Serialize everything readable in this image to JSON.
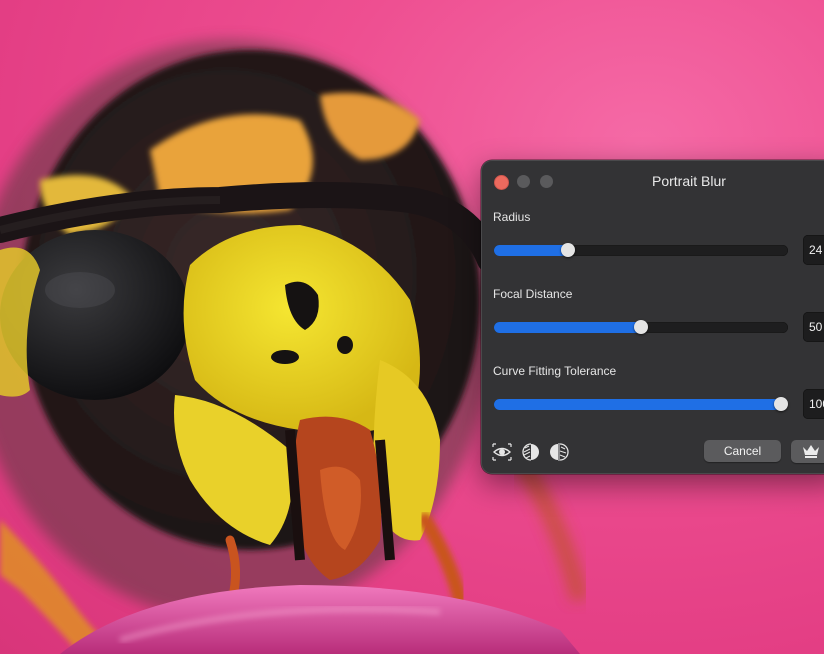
{
  "dialog": {
    "title": "Portrait Blur",
    "sliders": [
      {
        "label": "Radius",
        "value": "24",
        "fraction": 0.24
      },
      {
        "label": "Focal Distance",
        "value": "50",
        "fraction": 0.5
      },
      {
        "label": "Curve Fitting Tolerance",
        "value": "100",
        "fraction": 1.0
      }
    ],
    "buttons": {
      "cancel": "Cancel"
    },
    "icons": [
      "eye-icon",
      "compare-split-icon",
      "compare-mirror-icon",
      "crown-icon"
    ]
  },
  "colors": {
    "accent": "#1f6fe5",
    "panel": "#333335",
    "background": "#e94a8c"
  }
}
